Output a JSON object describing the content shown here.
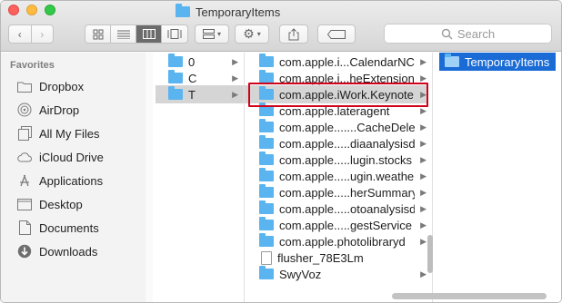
{
  "window": {
    "title": "TemporaryItems"
  },
  "toolbar": {
    "back_icon": "chevron-left-icon",
    "forward_icon": "chevron-right-icon",
    "view_icons": [
      "icon-view-icon",
      "list-view-icon",
      "column-view-icon",
      "gallery-view-icon"
    ],
    "active_view": "column",
    "search_placeholder": "Search"
  },
  "sidebar": {
    "heading": "Favorites",
    "items": [
      {
        "label": "Dropbox",
        "icon": "folder-icon"
      },
      {
        "label": "AirDrop",
        "icon": "airdrop-icon"
      },
      {
        "label": "All My Files",
        "icon": "all-files-icon"
      },
      {
        "label": "iCloud Drive",
        "icon": "cloud-icon"
      },
      {
        "label": "Applications",
        "icon": "applications-icon"
      },
      {
        "label": "Desktop",
        "icon": "desktop-icon"
      },
      {
        "label": "Documents",
        "icon": "documents-icon"
      },
      {
        "label": "Downloads",
        "icon": "downloads-icon"
      }
    ]
  },
  "columns": {
    "col1": [
      "0",
      "C",
      "T"
    ],
    "col2": [
      {
        "name": "com.apple.i...CalendarNC",
        "type": "folder"
      },
      {
        "name": "com.apple.i...heExtension",
        "type": "folder"
      },
      {
        "name": "com.apple.iWork.Keynote",
        "type": "folder"
      },
      {
        "name": "com.apple.lateragent",
        "type": "folder"
      },
      {
        "name": "com.apple.......CacheDelete",
        "type": "folder"
      },
      {
        "name": "com.apple.....diaanalysisd",
        "type": "folder"
      },
      {
        "name": "com.apple.....lugin.stocks",
        "type": "folder"
      },
      {
        "name": "com.apple.....ugin.weather",
        "type": "folder"
      },
      {
        "name": "com.apple.....herSummary",
        "type": "folder"
      },
      {
        "name": "com.apple.....otoanalysisd",
        "type": "folder"
      },
      {
        "name": "com.apple.....gestService",
        "type": "folder"
      },
      {
        "name": "com.apple.photolibraryd",
        "type": "folder"
      },
      {
        "name": "flusher_78E3Lm",
        "type": "file"
      },
      {
        "name": "SwyVoz",
        "type": "folder"
      }
    ],
    "col3": [
      "TemporaryItems"
    ]
  },
  "colors": {
    "selection_blue": "#1a6bd5",
    "folder": "#5ab4ef",
    "highlight_box": "#d0021b"
  }
}
